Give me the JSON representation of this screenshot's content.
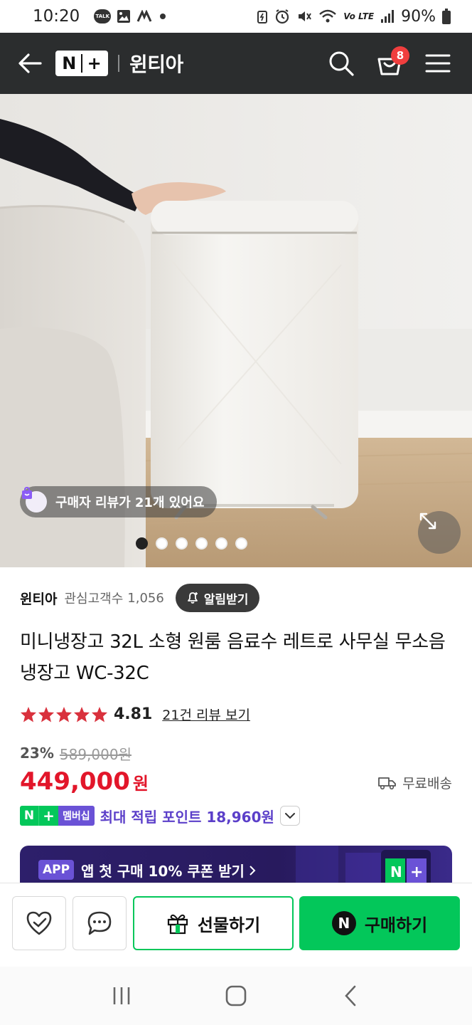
{
  "status_bar": {
    "time": "10:20",
    "talk_label": "TALK",
    "battery": "90%",
    "network": "Vo LTE"
  },
  "header": {
    "store_name": "윈티아",
    "cart_count": "8",
    "icons": [
      "back-arrow-icon",
      "search-icon",
      "cart-icon",
      "menu-icon"
    ]
  },
  "hero": {
    "review_pill": "구매자 리뷰가 21개 있어요",
    "dots_total": 6,
    "dots_active": 1
  },
  "store": {
    "name": "윈티아",
    "fav_label": "관심고객수",
    "fav_count": "1,056",
    "alarm_label": "알림받기"
  },
  "product": {
    "title": "미니냉장고 32L 소형 원룸 음료수 레트로 사무실 무소음 냉장고 WC-32C",
    "rating": "4.81",
    "stars": 5,
    "review_link": "21건 리뷰 보기",
    "discount_rate": "23%",
    "original_price": "589,000원",
    "sale_price": "449,000",
    "currency": "원",
    "shipping": "무료배송",
    "membership_label": "멤버십",
    "point_text": "최대 적립 포인트 18,960원"
  },
  "app_banner": {
    "tag": "APP",
    "text": "앱 첫 구매 10% 쿠폰 받기"
  },
  "actions": {
    "gift_label": "선물하기",
    "buy_label": "구매하기"
  },
  "colors": {
    "brand_green": "#03c75a",
    "price_red": "#e2162a",
    "point_purple": "#5b3fc9",
    "header_bg": "#2b2d2e"
  }
}
